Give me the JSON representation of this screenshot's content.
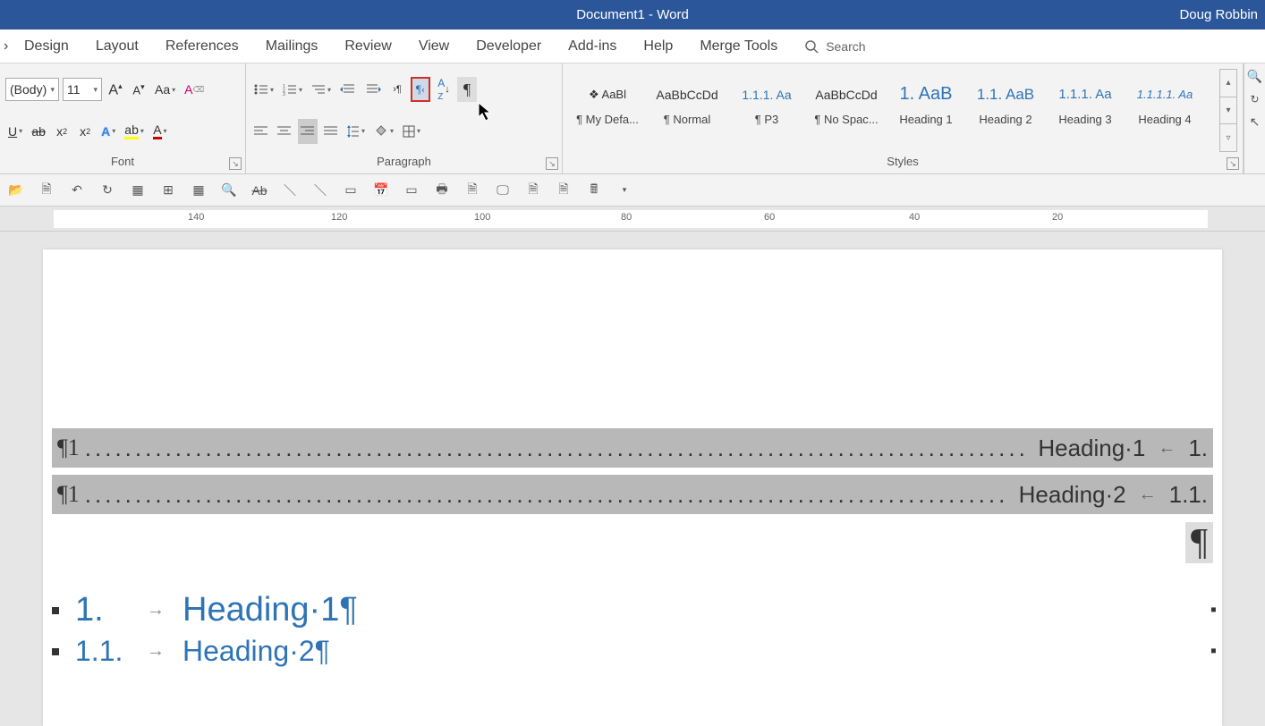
{
  "titlebar": {
    "title": "Document1  -  Word",
    "user": "Doug Robbin"
  },
  "menu": {
    "tabs": [
      "Design",
      "Layout",
      "References",
      "Mailings",
      "Review",
      "View",
      "Developer",
      "Add-ins",
      "Help",
      "Merge Tools"
    ],
    "search": "Search"
  },
  "font": {
    "name": "(Body)",
    "size": "11",
    "group_label": "Font"
  },
  "paragraph": {
    "group_label": "Paragraph"
  },
  "styles": {
    "group_label": "Styles",
    "items": [
      {
        "preview": "❖    AaBl",
        "name": "¶ My Defa..."
      },
      {
        "preview": "AaBbCcDd",
        "name": "¶ Normal"
      },
      {
        "preview": "1.1.1.  Aa",
        "name": "¶ P3"
      },
      {
        "preview": "AaBbCcDd",
        "name": "¶ No Spac..."
      },
      {
        "preview": "1.  AaB",
        "name": "Heading 1"
      },
      {
        "preview": "1.1.  AaB",
        "name": "Heading 2"
      },
      {
        "preview": "1.1.1.  Aa",
        "name": "Heading 3"
      },
      {
        "preview": "1.1.1.1.  Aa",
        "name": "Heading 4"
      }
    ]
  },
  "ruler": {
    "ticks": [
      "140",
      "120",
      "100",
      "80",
      "60",
      "40",
      "20"
    ]
  },
  "document": {
    "toc": [
      {
        "prefix": "¶1",
        "label": "Heading·1",
        "arrow": "←",
        "page": "1."
      },
      {
        "prefix": "¶1",
        "label": "Heading·2",
        "arrow": "←",
        "page": "1.1."
      }
    ],
    "headings": [
      {
        "num": "1.",
        "text": "Heading·1¶"
      },
      {
        "num": "1.1.",
        "text": "Heading·2¶"
      }
    ],
    "pilcrow": "¶"
  }
}
